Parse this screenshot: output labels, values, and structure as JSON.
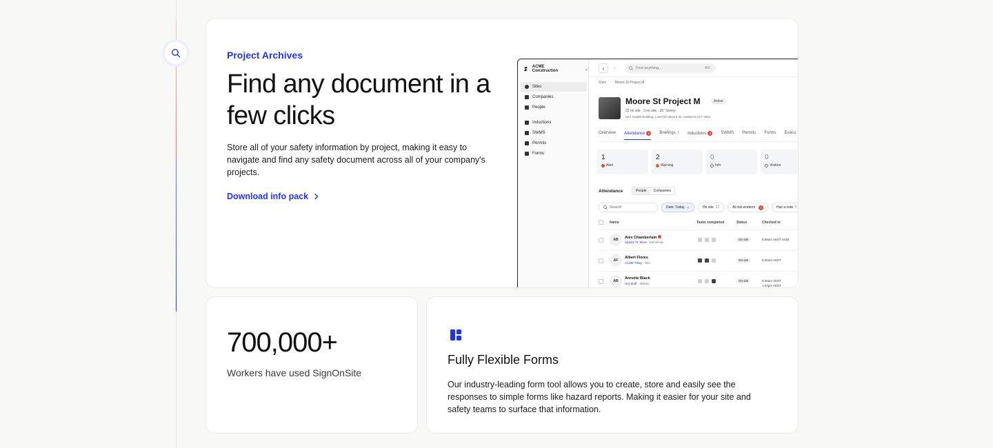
{
  "colors": {
    "accent": "#2536d8",
    "background": "#f8f8f7",
    "card": "#ffffff",
    "alert_red": "#d94a3a"
  },
  "feature": {
    "eyebrow": "Project Archives",
    "headline": "Find any document in a few clicks",
    "body": "Store all of your safety information by project, making it easy to navigate and find any safety document across all of your company's projects.",
    "cta_label": "Download info pack"
  },
  "screenshot": {
    "org_name": "ACME Construction",
    "nav_items": [
      {
        "label": "Sites",
        "active": true
      },
      {
        "label": "Companies"
      },
      {
        "label": "People"
      },
      {
        "label": "Inductions"
      },
      {
        "label": "SWMS"
      },
      {
        "label": "Permits"
      },
      {
        "label": "Forms"
      }
    ],
    "search_placeholder": "Find anything...",
    "search_shortcut": "⌘K",
    "breadcrumb": [
      "Sites",
      "Moore St Project M"
    ],
    "project": {
      "title": "Moore St Project M",
      "badge": "Active",
      "meta": "22 on site   ·   3 on site   ·   35° Sunny",
      "address": "ACT Health Building, Level 5/1 Moore St, Canberra ACT 2601"
    },
    "tabs": [
      {
        "label": "Overview"
      },
      {
        "label": "Attendance",
        "count": "1",
        "active": true
      },
      {
        "label": "Briefings",
        "num": "1"
      },
      {
        "label": "Inductions",
        "count": "2"
      },
      {
        "label": "SWMS"
      },
      {
        "label": "Permits"
      },
      {
        "label": "Forms"
      },
      {
        "label": "Evacu"
      }
    ],
    "stats": [
      {
        "value": "1",
        "label": "Alert",
        "kind": "red"
      },
      {
        "value": "2",
        "label": "Warning",
        "kind": "amber"
      },
      {
        "value": "0",
        "label": "Info",
        "kind": "grey"
      },
      {
        "value": "0",
        "label": "Visitors",
        "kind": "grey"
      }
    ],
    "attendance": {
      "title": "Attendance",
      "segments": [
        "People",
        "Companies"
      ],
      "search_placeholder": "Search",
      "filters": [
        {
          "label": "Date: Today",
          "kind": "date"
        },
        {
          "label": "On site",
          "count": "22"
        },
        {
          "label": "At risk workers",
          "count": "1"
        },
        {
          "label": "Has a note",
          "count": "5"
        }
      ],
      "columns": [
        "Name",
        "Tasks completed",
        "Status",
        "Checked in"
      ],
      "rows": [
        {
          "initials": "AB",
          "name": "Alex Chamberlain",
          "company": "Sparks 'N' More",
          "role": "Electrician",
          "status": "On site",
          "checkin": "8:06am AEDT (edit)"
        },
        {
          "initials": "AF",
          "name": "Albert Flores",
          "company": "ACME Tiling",
          "role": "Tiler",
          "status": "On site",
          "checkin": "8:30am AEDT"
        },
        {
          "initials": "AB",
          "name": "Annette Black",
          "company": "Hot Stuff",
          "role": "Welder",
          "status": "On site",
          "checkin": "8:58am AEDT",
          "checkin2": "1:03pm AEDT"
        }
      ]
    }
  },
  "stat_card": {
    "value": "700,000+",
    "label": "Workers have used SignOnSite"
  },
  "forms_card": {
    "icon": "layout-icon",
    "title": "Fully Flexible Forms",
    "body": "Our industry-leading form tool allows you to create, store and easily see the responses to simple forms like hazard reports. Making it easier for your site and safety teams to surface that information."
  }
}
